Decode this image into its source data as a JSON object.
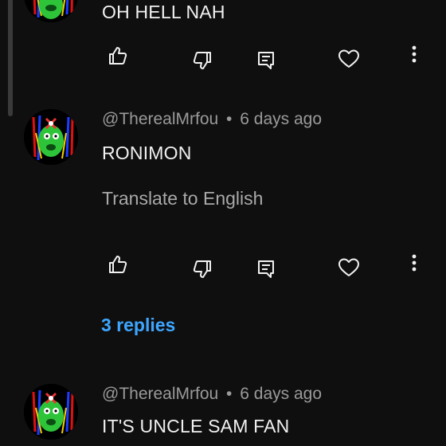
{
  "comments": [
    {
      "text": "OH HELL NAH",
      "actions": {
        "like": "thumbs-up-icon",
        "dislike": "thumbs-down-icon",
        "reply": "reply-icon",
        "love": "heart-icon",
        "more": "more-vert-icon"
      }
    },
    {
      "author": "@TherealMrfou",
      "separator": "•",
      "time": "6 days ago",
      "text": "RONIMON",
      "translate_label": "Translate to English",
      "replies_label": "3 replies"
    },
    {
      "author": "@TherealMrfou",
      "separator": "•",
      "time": "6 days ago",
      "text": "IT'S UNCLE SAM FAN"
    }
  ],
  "colors": {
    "background": "#0f0f0f",
    "text": "#f1f1f1",
    "meta": "#9a9a9a",
    "link": "#3ea6ff"
  }
}
